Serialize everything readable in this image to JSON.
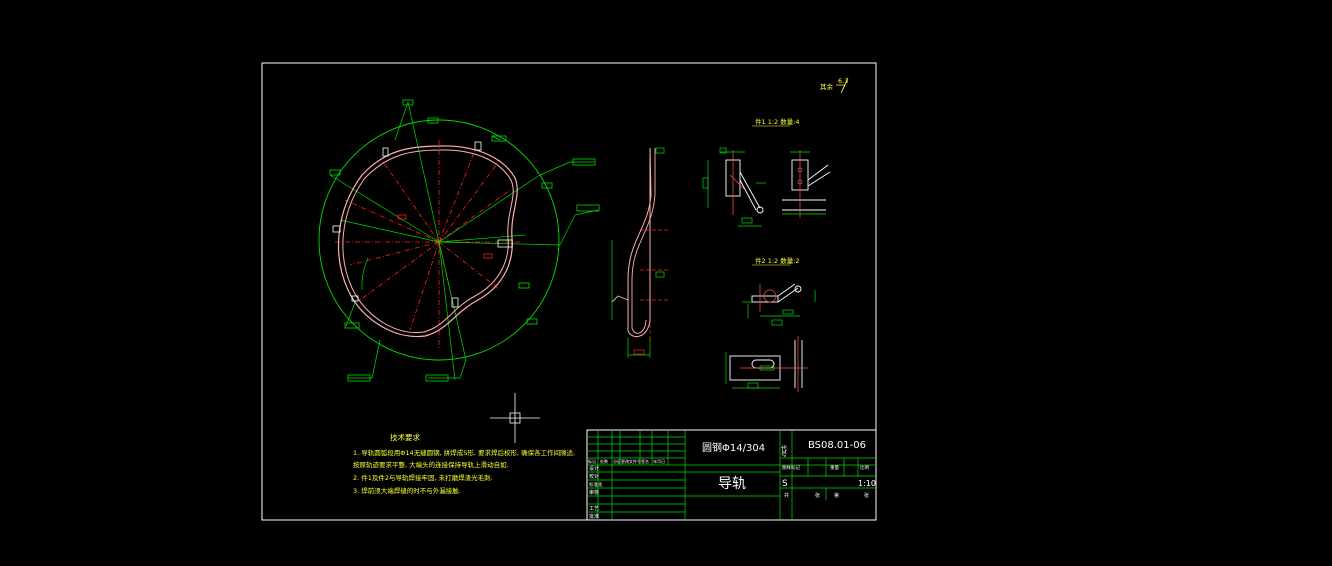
{
  "colors": {
    "background": "#000000",
    "border": "#ffffff",
    "dimension": "#00ff00",
    "centerline": "#ff2020",
    "outline": "#ffb0b0",
    "text": "#ffff33"
  },
  "roughness": {
    "label": "其余",
    "value": "6.3"
  },
  "views": {
    "partA_label": "件1  1:2  数量:4",
    "partB_label": "件2  1:2  数量:2"
  },
  "tech_notes": {
    "title": "技术要求",
    "lines": [
      "1. 导轨圆弧段用Φ14无缝圆钢, 拼焊成S形, 要求焊后校形, 确保各工作间隙适,",
      "   按原轨迹要求平整, 大端头的连接保持导轨上滑动自如.",
      "2. 件1及件2与导轨焊接牢固, 未打磨焊渣光毛刺.",
      "3. 焊前须大端焊缝的时不与外漏接触."
    ]
  },
  "title_block": {
    "material": "圆钢Φ14/304",
    "drawing_no_label": "代号",
    "drawing_no": "BS08.01-06",
    "part_name": "导轨",
    "stage_headers": [
      "图样标记",
      "重量",
      "比例"
    ],
    "stage_mark": "S",
    "scale": "1:10",
    "sheet_labels": [
      "共",
      "张",
      "第",
      "张"
    ],
    "rev_headers": [
      "标记",
      "处数",
      "分区",
      "更改文件号",
      "签名",
      "年月日"
    ],
    "role_labels": [
      "设计",
      "校对",
      "标准化",
      "审核",
      "工艺",
      "批准"
    ]
  }
}
